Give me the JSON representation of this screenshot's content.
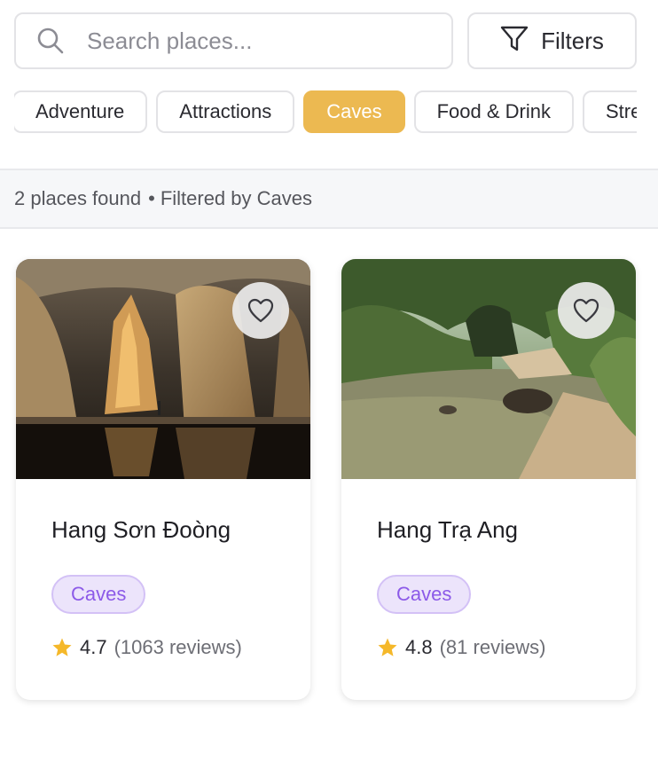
{
  "search": {
    "placeholder": "Search places...",
    "value": ""
  },
  "filters_button": {
    "label": "Filters"
  },
  "categories": [
    {
      "label": "Adventure",
      "active": false
    },
    {
      "label": "Attractions",
      "active": false
    },
    {
      "label": "Caves",
      "active": true
    },
    {
      "label": "Food & Drink",
      "active": false
    },
    {
      "label": "Streets",
      "active": false
    }
  ],
  "results": {
    "count_text": "2 places found",
    "separator": "•",
    "filter_text": "Filtered by Caves"
  },
  "places": [
    {
      "name": "Hang Sơn Đoòng",
      "tag": "Caves",
      "rating": "4.7",
      "reviews": "(1063 reviews)",
      "favorited": false
    },
    {
      "name": "Hang Trạ Ang",
      "tag": "Caves",
      "rating": "4.8",
      "reviews": "(81 reviews)",
      "favorited": false
    }
  ],
  "colors": {
    "accent": "#ecb951",
    "tag_bg": "#ece4fb",
    "tag_text": "#8c5ae8",
    "star": "#f5b82a"
  },
  "icons": {
    "search": "search-icon",
    "filter": "filter-icon",
    "favorite": "heart-icon",
    "rating": "star-icon"
  }
}
